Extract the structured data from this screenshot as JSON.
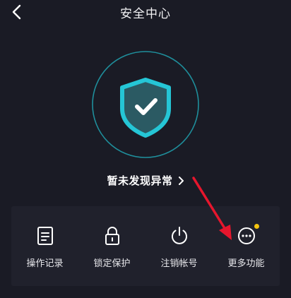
{
  "header": {
    "title": "安全中心",
    "back_icon": "chevron-left-icon"
  },
  "status": {
    "text": "暂未发现异常",
    "icon": "shield-check-icon",
    "chevron": "chevron-right-icon"
  },
  "functions": [
    {
      "label": "操作记录",
      "icon": "document-icon"
    },
    {
      "label": "锁定保护",
      "icon": "lock-icon"
    },
    {
      "label": "注销帐号",
      "icon": "power-icon"
    },
    {
      "label": "更多功能",
      "icon": "more-icon",
      "badge": true
    }
  ],
  "colors": {
    "background": "#1a1b25",
    "panel": "#20212c",
    "shield_accent": "#25c6d6",
    "badge": "#f4c40f",
    "arrow": "#e6162d"
  }
}
